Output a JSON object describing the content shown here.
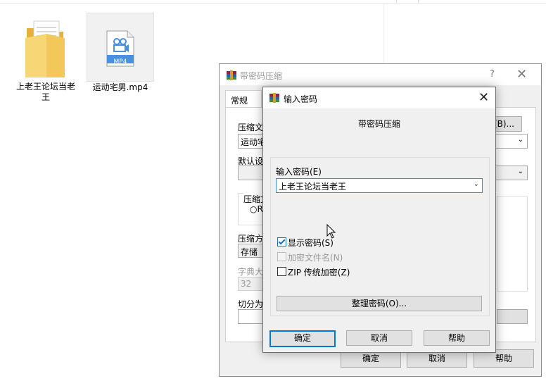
{
  "desktop": {
    "files": [
      {
        "name": "上老王论坛当老王",
        "type": "folder"
      },
      {
        "name": "运动宅男.mp4",
        "type": "video",
        "badge": "MP4"
      }
    ]
  },
  "bg_dialog": {
    "title": "带密码压缩",
    "help": "?",
    "close": "✕",
    "tab_general": "常规",
    "labels": {
      "archive_name": "压缩文",
      "archive_value": "运动宅",
      "defaults": "默认设",
      "archive_format": "压缩文",
      "radio_partial": "R",
      "compression_method": "压缩方",
      "method_value": "存储",
      "dict_size": "字典大",
      "dict_value": "32",
      "split": "切分为"
    },
    "browse_button": "(B)...",
    "ok": "确定",
    "cancel": "取消",
    "help_button": "帮助"
  },
  "fg_dialog": {
    "title": "输入密码",
    "close": "✕",
    "heading": "带密码压缩",
    "password_label": "输入密码(E)",
    "password_value": "上老王论坛当老王",
    "show_password": {
      "label": "显示密码(S)",
      "checked": true
    },
    "encrypt_names": {
      "label": "加密文件名(N)",
      "checked": false,
      "disabled": true
    },
    "zip_legacy": {
      "label": "ZIP 传统加密(Z)",
      "checked": false
    },
    "organize_button": "整理密码(O)...",
    "ok": "确定",
    "cancel": "取消",
    "help": "帮助"
  },
  "colors": {
    "accent": "#0078d7",
    "folder": "#f3c85a",
    "mp4_badge": "#4a90e2"
  }
}
